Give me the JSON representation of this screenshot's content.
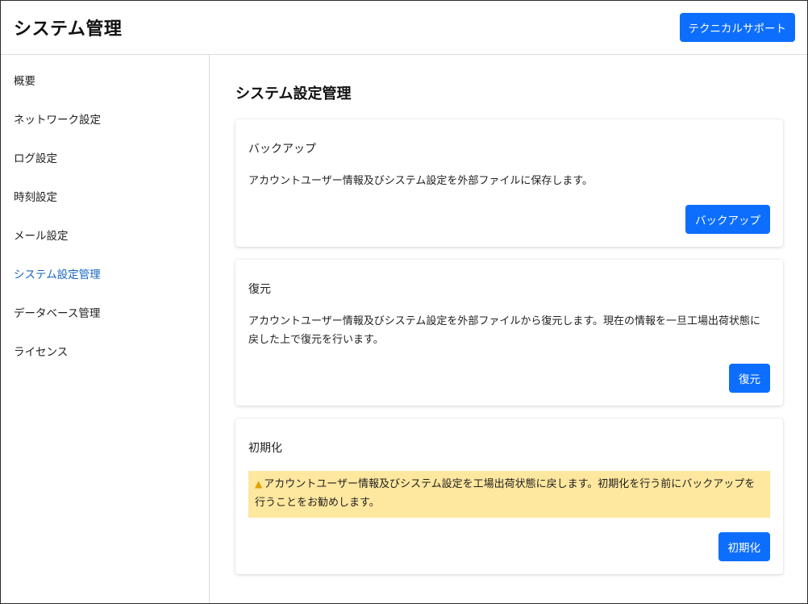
{
  "header": {
    "title": "システム管理",
    "support_label": "テクニカルサポート"
  },
  "sidebar": {
    "items": [
      {
        "label": "概要"
      },
      {
        "label": "ネットワーク設定"
      },
      {
        "label": "ログ設定"
      },
      {
        "label": "時刻設定"
      },
      {
        "label": "メール設定"
      },
      {
        "label": "システム設定管理"
      },
      {
        "label": "データベース管理"
      },
      {
        "label": "ライセンス"
      }
    ],
    "active_index": 5
  },
  "main": {
    "title": "システム設定管理",
    "cards": [
      {
        "title": "バックアップ",
        "description": "アカウントユーザー情報及びシステム設定を外部ファイルに保存します。",
        "button_label": "バックアップ"
      },
      {
        "title": "復元",
        "description": "アカウントユーザー情報及びシステム設定を外部ファイルから復元します。現在の情報を一旦工場出荷状態に戻した上で復元を行います。",
        "button_label": "復元"
      },
      {
        "title": "初期化",
        "warning_icon": "warning-triangle-icon",
        "warning": "アカウントユーザー情報及びシステム設定を工場出荷状態に戻します。初期化を行う前にバックアップを行うことをお勧めします。",
        "button_label": "初期化"
      }
    ]
  },
  "colors": {
    "primary": "#0d6efd",
    "active_nav": "#1565c0",
    "warning_bg": "#fee79e",
    "warning_icon": "#e3a000"
  }
}
